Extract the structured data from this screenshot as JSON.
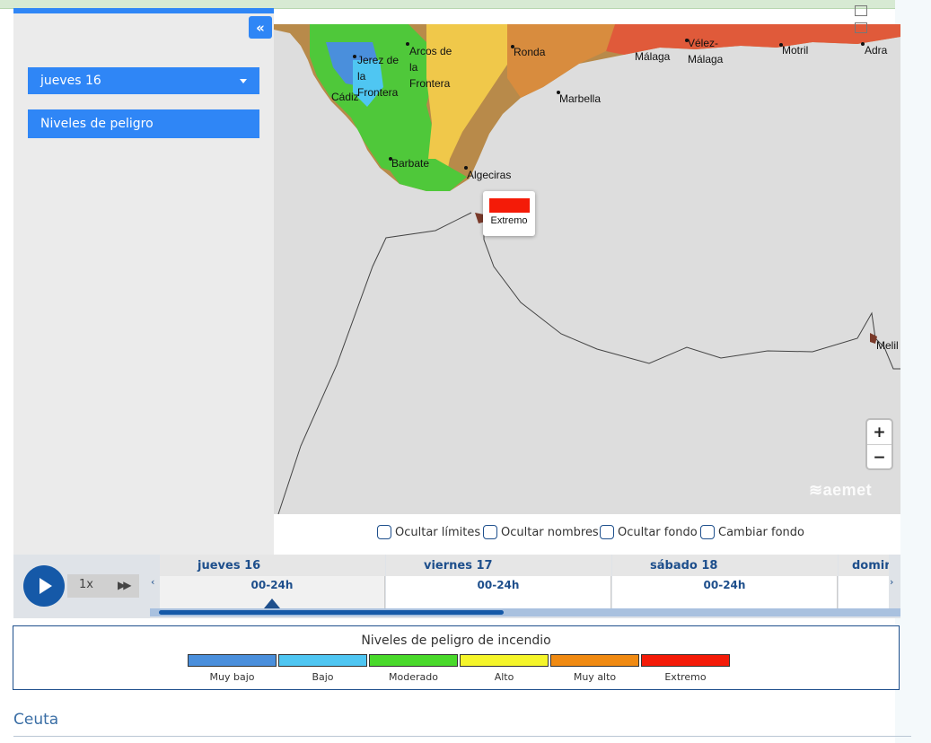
{
  "sidebar": {
    "collapse_glyph": "«",
    "selected_day": "jueves 16",
    "levels_button": "Niveles de peligro"
  },
  "map": {
    "cities": [
      {
        "name": "Jerez de"
      },
      {
        "name": "la"
      },
      {
        "name": "Frontera"
      },
      {
        "name": "Arcos de"
      },
      {
        "name": "la"
      },
      {
        "name": "Frontera"
      },
      {
        "name": "Cádiz"
      },
      {
        "name": "Ronda"
      },
      {
        "name": "Vélez-"
      },
      {
        "name": "Málaga"
      },
      {
        "name": "Málaga"
      },
      {
        "name": "Motril"
      },
      {
        "name": "Adra"
      },
      {
        "name": "Marbella"
      },
      {
        "name": "Barbate"
      },
      {
        "name": "Algeciras"
      },
      {
        "name": "Melil"
      }
    ],
    "popup_label": "Extremo",
    "popup_color": "#f41b08",
    "zoom_in": "+",
    "zoom_out": "−",
    "logo_text": "aemet"
  },
  "map_controls": {
    "options": [
      "Ocultar límites",
      "Ocultar nombres",
      "Ocultar fondo",
      "Cambiar fondo"
    ]
  },
  "timebar": {
    "speed": "1x",
    "ff_glyph": "▶▶",
    "days": [
      {
        "label": "jueves 16",
        "slot": "00-24h"
      },
      {
        "label": "viernes 17",
        "slot": "00-24h"
      },
      {
        "label": "sábado 18",
        "slot": "00-24h"
      },
      {
        "label": "domingo",
        "slot": ""
      }
    ],
    "left_arrow": "‹",
    "right_arrow": "›"
  },
  "legend": {
    "title": "Niveles de peligro de incendio",
    "items": [
      {
        "label": "Muy bajo",
        "color": "#4a8fdc"
      },
      {
        "label": "Bajo",
        "color": "#4fc6f2"
      },
      {
        "label": "Moderado",
        "color": "#49d92b"
      },
      {
        "label": "Alto",
        "color": "#f5f52a"
      },
      {
        "label": "Muy alto",
        "color": "#f08a12"
      },
      {
        "label": "Extremo",
        "color": "#f41b08"
      }
    ]
  },
  "section": {
    "title": "Ceuta"
  }
}
